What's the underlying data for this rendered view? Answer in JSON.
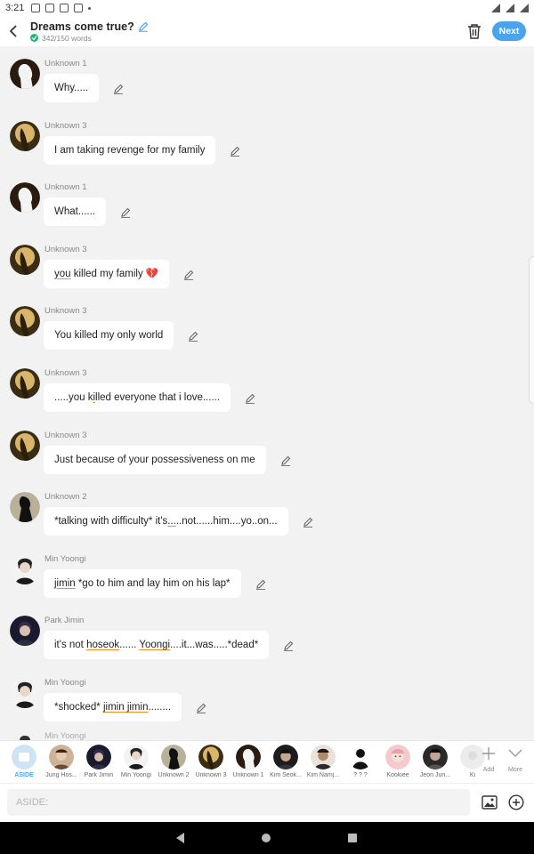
{
  "status_bar": {
    "time": "3:21"
  },
  "header": {
    "title": "Dreams come true?",
    "word_count": "342/150 words",
    "next_label": "Next"
  },
  "messages": [
    {
      "sender": "Unknown 1",
      "avatar": "silhouette",
      "parts": [
        {
          "t": "Why....."
        }
      ]
    },
    {
      "sender": "Unknown 3",
      "avatar": "gold",
      "parts": [
        {
          "t": "I am taking revenge for my family"
        }
      ]
    },
    {
      "sender": "Unknown 1",
      "avatar": "silhouette",
      "parts": [
        {
          "t": "What......"
        }
      ]
    },
    {
      "sender": "Unknown 3",
      "avatar": "gold",
      "parts": [
        {
          "t": "you",
          "u": true
        },
        {
          "t": " killed my family "
        },
        {
          "t": "💔",
          "heart": true
        }
      ]
    },
    {
      "sender": "Unknown 3",
      "avatar": "gold",
      "parts": [
        {
          "t": "You killed my only world"
        }
      ]
    },
    {
      "sender": "Unknown 3",
      "avatar": "gold",
      "parts": [
        {
          "t": ".....you k"
        },
        {
          "t": "i",
          "u": true
        },
        {
          "t": "lled everyone that i love......"
        }
      ]
    },
    {
      "sender": "Unknown 3",
      "avatar": "gold",
      "parts": [
        {
          "t": "Just because of your possessiveness on me"
        }
      ]
    },
    {
      "sender": "Unknown 2",
      "avatar": "dark",
      "parts": [
        {
          "t": "*talking with difficulty* it's"
        },
        {
          "t": "...",
          "u": true
        },
        {
          "t": "..not......him....yo..on..."
        }
      ]
    },
    {
      "sender": "Min Yoongi",
      "avatar": "yoongi",
      "parts": [
        {
          "t": "jimin",
          "u": true
        },
        {
          "t": " *go to him and lay him on his lap*"
        }
      ]
    },
    {
      "sender": "Park Jimin",
      "avatar": "jimin",
      "parts": [
        {
          "t": "it's not "
        },
        {
          "t": "hoseok",
          "u": true
        },
        {
          "t": "...... "
        },
        {
          "t": "Yoongi",
          "u": true
        },
        {
          "t": "....it...was.....*dead*"
        }
      ]
    },
    {
      "sender": "Min Yoongi",
      "avatar": "yoongi",
      "parts": [
        {
          "t": "*shocked* "
        },
        {
          "t": "jimin jimin",
          "u": true
        },
        {
          "t": "........"
        }
      ]
    }
  ],
  "partial_sender": "Min Yoongi",
  "characters": [
    {
      "name": "ASIDE",
      "avatar": "aside"
    },
    {
      "name": "Jung Hos...",
      "avatar": "hoseok"
    },
    {
      "name": "Park Jimin",
      "avatar": "jimin"
    },
    {
      "name": "Min Yoongi",
      "avatar": "yoongi"
    },
    {
      "name": "Unknown 2",
      "avatar": "dark"
    },
    {
      "name": "Unknown 3",
      "avatar": "gold"
    },
    {
      "name": "Unknown 1",
      "avatar": "silhouette"
    },
    {
      "name": "Kim Seok...",
      "avatar": "seokjin"
    },
    {
      "name": "Kim Namj...",
      "avatar": "namjoon"
    },
    {
      "name": "? ? ?",
      "avatar": "unknown"
    },
    {
      "name": "Kookiee",
      "avatar": "kookie"
    },
    {
      "name": "Jeon Jun...",
      "avatar": "jungkook"
    },
    {
      "name": "Ki",
      "avatar": "extra"
    }
  ],
  "tools": {
    "add_label": "Add",
    "more_label": "More"
  },
  "input": {
    "placeholder": "ASIDE:"
  },
  "colors": {
    "accent": "#4aa3ee",
    "check": "#22b573",
    "underline": "#f28c1d"
  }
}
